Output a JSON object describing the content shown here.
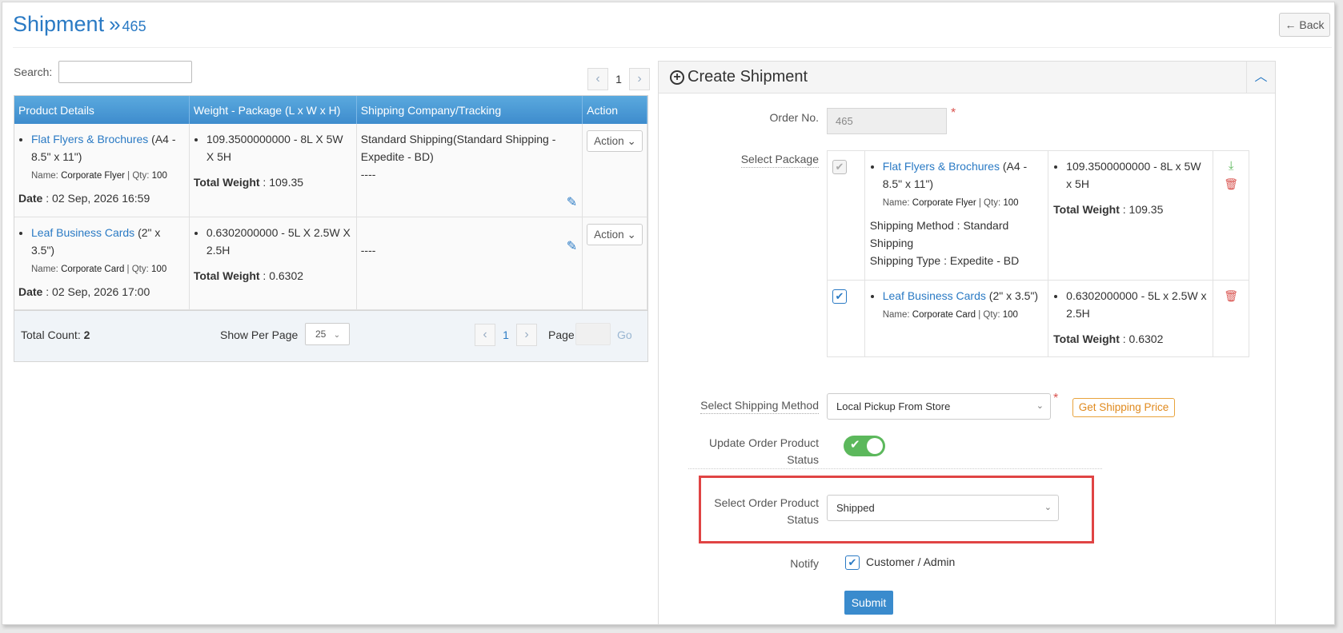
{
  "page": {
    "title": "Shipment",
    "title_sep": "»",
    "order_id": "465",
    "back_label": "← Back"
  },
  "search": {
    "label": "Search:",
    "value": ""
  },
  "pager_top": {
    "prev": "‹",
    "page": "1",
    "next": "›"
  },
  "grid": {
    "columns": [
      "Product Details",
      "Weight - Package (L x W x H)",
      "Shipping Company/Tracking",
      "Action"
    ],
    "rows": [
      {
        "product_link": "Flat Flyers & Brochures",
        "product_size": " (A4 - 8.5\" x 11\")",
        "name_label": "Name:",
        "name_value": "Corporate Flyer",
        "qty_label": "Qty:",
        "qty_value": "100",
        "date_label": "Date",
        "date_value": " : 02 Sep, 2026 16:59",
        "weight_line": "109.3500000000 - 8L X 5W X 5H",
        "total_weight_label": "Total Weight",
        "total_weight_value": " : 109.35",
        "shipping": "Standard Shipping(Standard Shipping - Expedite - BD)",
        "tracking": "----",
        "action": "Action"
      },
      {
        "product_link": "Leaf Business Cards",
        "product_size": " (2\" x 3.5\")",
        "name_label": "Name:",
        "name_value": "Corporate Card",
        "qty_label": "Qty:",
        "qty_value": "100",
        "date_label": "Date",
        "date_value": " : 02 Sep, 2026 17:00",
        "weight_line": "0.6302000000 - 5L X 2.5W X 2.5H",
        "total_weight_label": "Total Weight",
        "total_weight_value": " : 0.6302",
        "shipping": "",
        "tracking": "----",
        "action": "Action"
      }
    ],
    "footer": {
      "total_label": "Total Count: ",
      "total_value": "2",
      "show_per_page": "Show Per Page",
      "per_page": "25",
      "page": "1",
      "page_label": "Page",
      "go": "Go"
    }
  },
  "panel": {
    "title": "Create Shipment",
    "order_no_label": "Order No.",
    "order_no_value": "465",
    "select_package_label": "Select Package",
    "packages": [
      {
        "checked": true,
        "disabled": true,
        "product_link": "Flat Flyers & Brochures",
        "product_size": " (A4 - 8.5\" x 11\")",
        "name_value": "Corporate Flyer",
        "qty_value": "100",
        "shipping_method": "Shipping Method : Standard Shipping",
        "shipping_type": "Shipping Type : Expedite - BD",
        "weight_line": "109.3500000000 - 8L x 5W x 5H",
        "total_weight_label": "Total Weight",
        "total_weight_value": " : 109.35"
      },
      {
        "checked": true,
        "disabled": false,
        "product_link": "Leaf Business Cards",
        "product_size": " (2\" x 3.5\")",
        "name_value": "Corporate Card",
        "qty_value": "100",
        "weight_line": "0.6302000000 - 5L x 2.5W x 2.5H",
        "total_weight_label": "Total Weight",
        "total_weight_value": " : 0.6302"
      }
    ],
    "shipping_method_label": "Select Shipping Method",
    "shipping_method_value": "Local Pickup From Store",
    "get_price_label": "Get Shipping Price",
    "update_status_label_1": "Update Order Product",
    "update_status_label_2": "Status",
    "select_status_label_1": "Select Order Product",
    "select_status_label_2": "Status",
    "select_status_value": "Shipped",
    "notify_label": "Notify",
    "notify_option": "Customer / Admin",
    "submit_label": "Submit"
  },
  "colors": {
    "accent": "#2a7ac4",
    "header": "#4a9ad6",
    "toggle_on": "#5cb85c",
    "danger": "#d9534f",
    "highlight": "#e04444"
  }
}
